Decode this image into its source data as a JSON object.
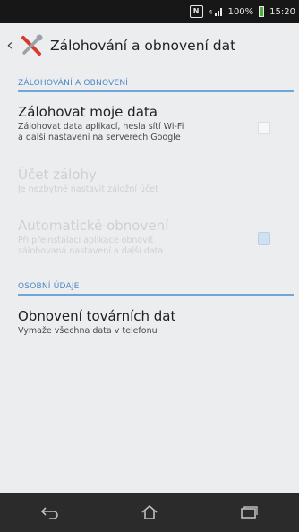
{
  "status_bar": {
    "nfc_label": "N",
    "signal_label": "4",
    "battery_label": "100%",
    "time": "15:20"
  },
  "app_bar": {
    "title": "Zálohování a obnovení dat"
  },
  "sections": [
    {
      "header": "ZÁLOHOVÁNÍ A OBNOVENÍ",
      "items": [
        {
          "title": "Zálohovat moje data",
          "subtitle_line1": "Zálohovat data aplikací, hesla sítí Wi-Fi",
          "subtitle_line2": "a další nastavení na serverech Google",
          "checked": false
        },
        {
          "title": "Účet zálohy",
          "subtitle_line1": "Je nezbytné nastavit záložní účet"
        },
        {
          "title": "Automatické obnovení",
          "subtitle_line1": "Při přeinstalaci aplikace obnovit",
          "subtitle_line2": "zálohovaná nastavení a další data",
          "checked": false
        }
      ]
    },
    {
      "header": "OSOBNÍ ÚDAJE",
      "items": [
        {
          "title": "Obnovení továrních dat",
          "subtitle_line1": "Vymaže všechna data v telefonu"
        }
      ]
    }
  ],
  "colors": {
    "accent": "#4f88c4",
    "background": "#ecedef",
    "status_bar": "#171717",
    "nav_bar": "#2b2b2b"
  },
  "icons": {
    "app_icon": "wrench-screwdriver-icon",
    "back": "chevron-left-icon",
    "nav_back": "back-arrow-icon",
    "nav_home": "home-icon",
    "nav_recent": "recent-apps-icon"
  }
}
